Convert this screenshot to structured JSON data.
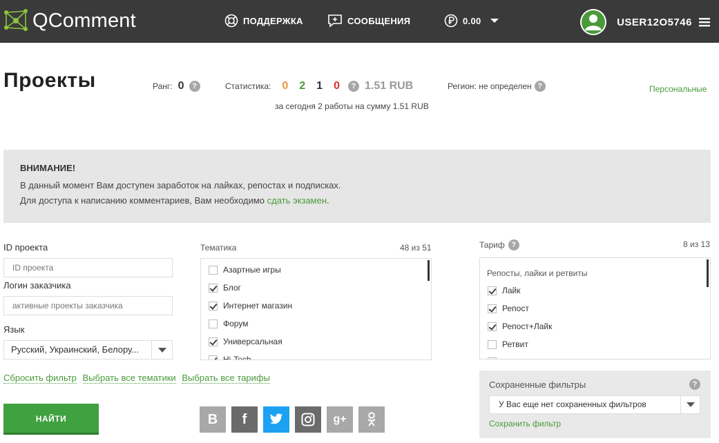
{
  "header": {
    "logo_text": "QComment",
    "support_label": "ПОДДЕРЖКА",
    "messages_label": "СООБЩЕНИЯ",
    "balance": "0.00",
    "username": "USER12O5746"
  },
  "title": "Проекты",
  "rank": {
    "label": "Ранг:",
    "value": "0",
    "help": "?"
  },
  "stats": {
    "label": "Статистика:",
    "values": [
      {
        "value": "0",
        "color": "#f0963a"
      },
      {
        "value": "2",
        "color": "#4a9a3a"
      },
      {
        "value": "1",
        "color": "#333333"
      },
      {
        "value": "0",
        "color": "#d9332b"
      }
    ],
    "sum": "1.51 RUB",
    "subtitle": "за сегодня 2 работы на сумму 1.51 RUB"
  },
  "region": {
    "label": "Регион: не определен"
  },
  "personal_link": "Персональные",
  "attention": {
    "title": "ВНИМАНИЕ!",
    "line1": "В данный момент Вам доступен заработок на лайках, репостах и подписках.",
    "line2_prefix": "Для доступа к написанию комментариев, Вам необходимо ",
    "line2_link": "сдать экзамен",
    "line2_suffix": "."
  },
  "filters": {
    "project_id_label": "ID проекта",
    "project_id_placeholder": "ID проекта",
    "customer_label": "Логин заказчика",
    "customer_placeholder": "активные проекты заказчика",
    "language_label": "Язык",
    "language_value": "Русский, Украинский, Белору..."
  },
  "topics": {
    "label": "Тематика",
    "count": "48 из 51",
    "items": [
      {
        "label": "Азартные игры",
        "checked": false
      },
      {
        "label": "Блог",
        "checked": true
      },
      {
        "label": "Интернет магазин",
        "checked": true
      },
      {
        "label": "Форум",
        "checked": false
      },
      {
        "label": "Универсальная",
        "checked": true
      },
      {
        "label": "Hi-Tech",
        "checked": true
      }
    ]
  },
  "tariff": {
    "label": "Тариф",
    "count": "8 из 13",
    "group": "Репосты, лайки и ретвиты",
    "items": [
      {
        "label": "Лайк",
        "checked": true
      },
      {
        "label": "Репост",
        "checked": true
      },
      {
        "label": "Репост+Лайк",
        "checked": true
      },
      {
        "label": "Ретвит",
        "checked": false
      },
      {
        "label": "",
        "checked": false
      }
    ]
  },
  "links": {
    "reset": "Сбросить фильтр",
    "all_topics": "Выбрать все тематики",
    "all_tariffs": "Выбрать все тарифы"
  },
  "find_button": "НАЙТИ",
  "social": [
    {
      "name": "vk-icon",
      "glyph": "В",
      "color": "#a8a8a8"
    },
    {
      "name": "facebook-icon",
      "glyph": "f",
      "color": "#6b6b6b"
    },
    {
      "name": "twitter-icon",
      "glyph": "",
      "color": "#1da1f2"
    },
    {
      "name": "instagram-icon",
      "glyph": "",
      "color": "#6b6b6b"
    },
    {
      "name": "google-plus-icon",
      "glyph": "g+",
      "color": "#a8a8a8"
    },
    {
      "name": "odnoklassniki-icon",
      "glyph": "ok",
      "color": "#a8a8a8"
    }
  ],
  "saved_filters": {
    "title": "Сохраненные фильтры",
    "select_value": "У Вас еще нет сохраненных фильтров",
    "save_link": "Сохранить фильтр"
  }
}
